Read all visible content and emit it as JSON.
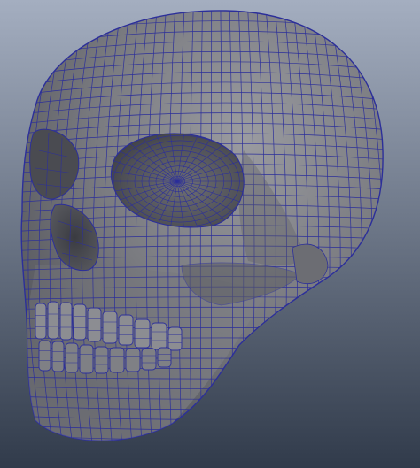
{
  "viewport": {
    "background_top": "#a4aec0",
    "background_bottom": "#313b4b",
    "model_fill": "#7a7b80",
    "model_shadow": "#4d4e54",
    "model_highlight": "#9a9ba0",
    "wireframe_color": "#2c2f9a",
    "wireframe_light": "#3c3fb6"
  }
}
